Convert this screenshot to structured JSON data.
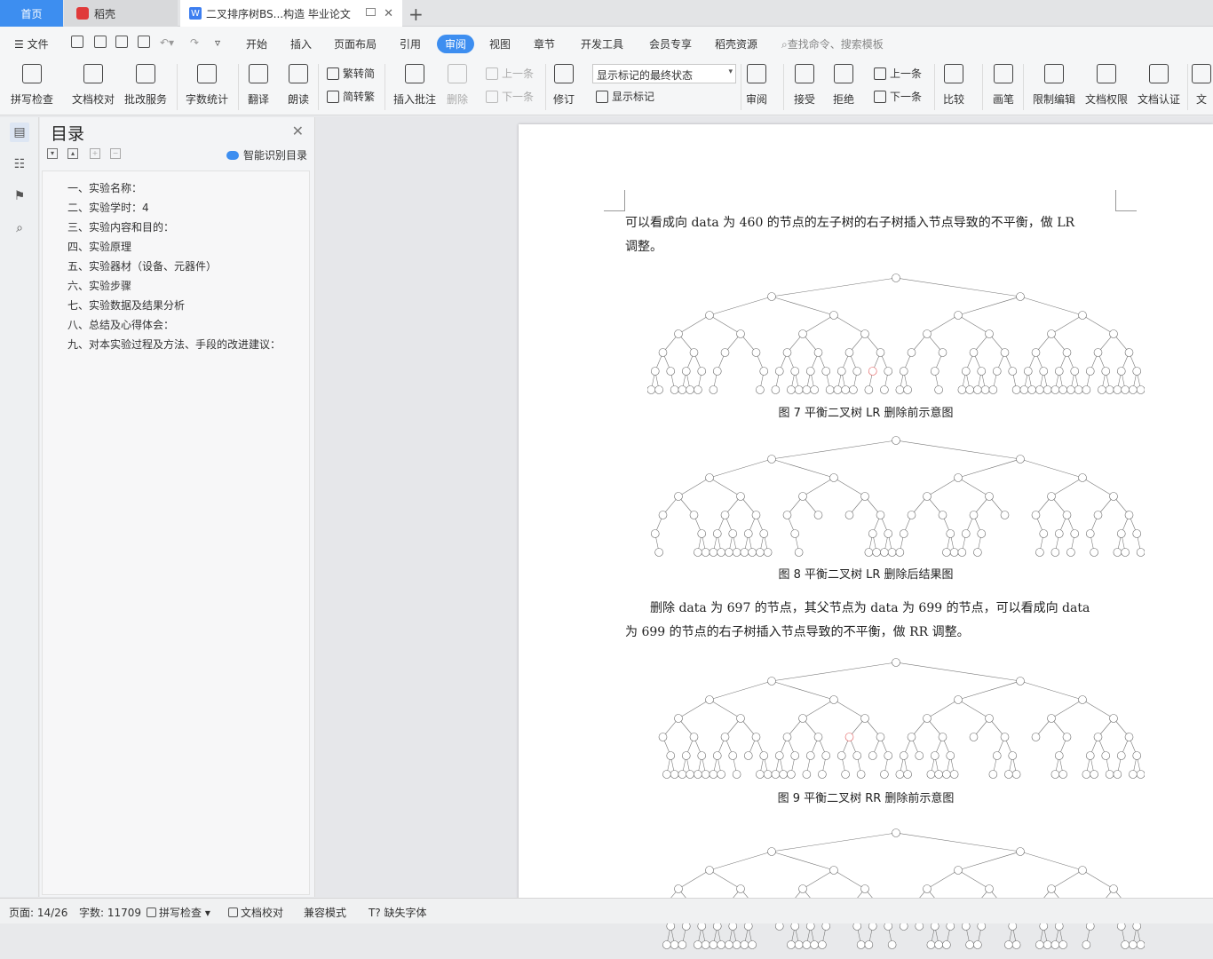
{
  "tabs": {
    "home": "首页",
    "docer": "稻壳",
    "document": "二叉排序树BS...构造 毕业论文"
  },
  "menu": {
    "file": "文件",
    "items": [
      "开始",
      "插入",
      "页面布局",
      "引用",
      "审阅",
      "视图",
      "章节",
      "开发工具",
      "会员专享",
      "稻壳资源"
    ],
    "search_placeholder": "查找命令、搜索模板"
  },
  "ribbon": {
    "spell_check": "拼写检查",
    "doc_proof": "文档校对",
    "revise_service": "批改服务",
    "word_count": "字数统计",
    "translate": "翻译",
    "read_aloud": "朗读",
    "to_traditional": "繁转简",
    "to_simplified": "简转繁",
    "insert_comment": "插入批注",
    "delete": "删除",
    "prev_comment": "上一条",
    "next_comment": "下一条",
    "track_changes": "修订",
    "markup_state": "显示标记的最终状态",
    "show_markup": "显示标记",
    "review": "审阅",
    "accept": "接受",
    "reject": "拒绝",
    "prev_change": "上一条",
    "next_change": "下一条",
    "compare": "比较",
    "pen": "画笔",
    "restrict_edit": "限制编辑",
    "doc_permission": "文档权限",
    "doc_cert": "文档认证",
    "more": "文"
  },
  "outline": {
    "title": "目录",
    "smart_toc": "智能识别目录",
    "items": [
      "一、实验名称：",
      "二、实验学时：4",
      "三、实验内容和目的：",
      "四、实验原理",
      "五、实验器材（设备、元器件）",
      "六、实验步骤",
      "七、实验数据及结果分析",
      "八、总结及心得体会：",
      "九、对本实验过程及方法、手段的改进建议："
    ]
  },
  "document": {
    "para1_line1": "可以看成向 data 为 460 的节点的左子树的右子树插入节点导致的不平衡，做 LR",
    "para1_line2": "调整。",
    "caption7": "图 7    平衡二叉树 LR 删除前示意图",
    "caption8": "图 8    平衡二叉树 LR 删除后结果图",
    "para2_line1": "删除 data 为 697 的节点，其父节点为 data 为 699 的节点，可以看成向 data",
    "para2_line2": "为 699 的节点的右子树插入节点导致的不平衡，做 RR 调整。",
    "caption9": "图 9    平衡二叉树 RR 删除前示意图"
  },
  "status": {
    "page": "页面: 14/26",
    "words": "字数: 11709",
    "spell": "拼写检查",
    "proof": "文档校对",
    "compat": "兼容模式",
    "missing_font": "缺失字体"
  },
  "colors": {
    "accent": "#3d8ef0",
    "highlight_node": "#e05050"
  }
}
